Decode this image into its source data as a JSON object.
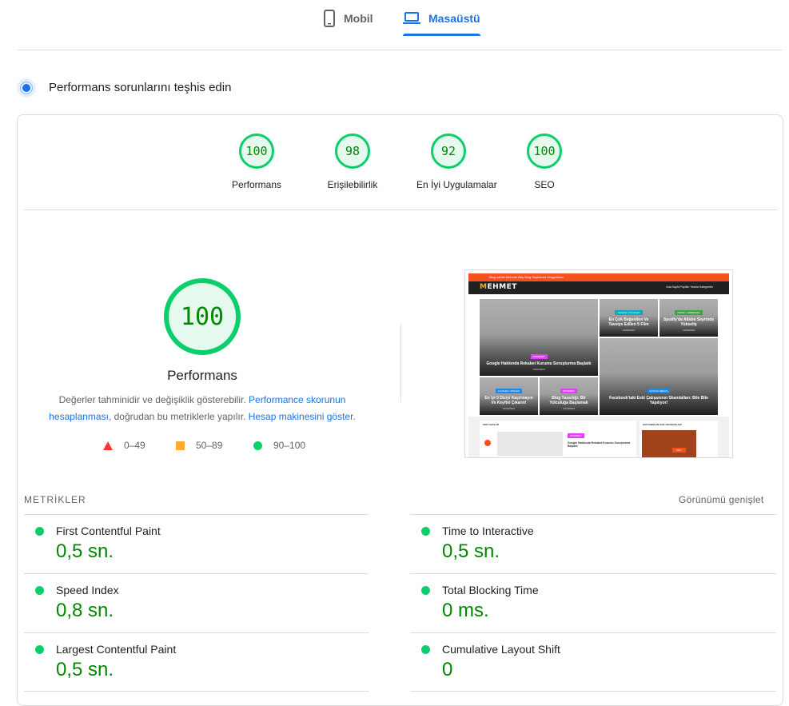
{
  "tabs": {
    "mobile": {
      "label": "Mobil",
      "icon": "phone-icon"
    },
    "desktop": {
      "label": "Masaüstü",
      "icon": "laptop-icon",
      "active": true
    }
  },
  "section": {
    "title": "Performans sorunlarını teşhis edin",
    "icon": "diagnose-icon"
  },
  "categories": [
    {
      "score": "100",
      "label": "Performans"
    },
    {
      "score": "98",
      "label": "Erişilebilirlik"
    },
    {
      "score": "92",
      "label": "En İyi Uygulamalar"
    },
    {
      "score": "100",
      "label": "SEO"
    }
  ],
  "main": {
    "score": "100",
    "label": "Performans",
    "note_text1": "Değerler tahminidir ve değişiklik gösterebilir.",
    "note_link1": "Performance skorunun hesaplanması",
    "note_text2": ", doğrudan bu metriklerle yapılır.",
    "note_link2": "Hesap makinesini göster",
    "note_text3": "."
  },
  "legend": [
    {
      "range": "0–49",
      "color": "#ff3333",
      "shape": "triangle"
    },
    {
      "range": "50–89",
      "color": "#ffaa33",
      "shape": "square"
    },
    {
      "range": "90–100",
      "color": "#0cce6b",
      "shape": "circle"
    }
  ],
  "thumbnail": {
    "topbar": "Blog sahibi Mehmet Bey Blog Sayfasına Hoşgeldiniz",
    "logo_m": "M",
    "logo_rest": "EHMET",
    "nav": "Ana Sayfa    Popüler Yazılar    Kategoriler",
    "tiles": [
      {
        "tag": "İNTERNET",
        "tag_color": "#e040fb",
        "title": "Google Hakkında Rekabet Kurumu Soruşturma Başlattı",
        "date": "13/09/2023"
      },
      {
        "tag": "YAZILIM / OYUNLAR",
        "tag_color": "#00acc1",
        "title": "En Çok Beğenilen Ve Tavsiye Edilen 5 Film",
        "date": "13/09/2023"
      },
      {
        "tag": "MÜZİK / HABERLER",
        "tag_color": "#43a047",
        "title": "Spotify'da Albüm Seyrinde Yükseliş",
        "date": "13/09/2023"
      },
      {
        "tag": "SOSYAL MEDYA",
        "tag_color": "#1e88e5",
        "title": "Facebook'taki Eski Çalışanının Skandalları: Bile Bile Yapılıyor!",
        "date": "13/09/2023"
      },
      {
        "tag": "FİLMLER / DİZİLER",
        "tag_color": "#1e88e5",
        "title": "En İyi 5 Diziyi Kaçırmayın Ve Keyfini Çıkarın!",
        "date": "13/09/2023"
      },
      {
        "tag": "İNTERNET",
        "tag_color": "#e040fb",
        "title": "Blog Yazarlığı: Bir Yolculuğa Başlamak",
        "date": "13/09/2023"
      }
    ],
    "panel_left": "SON YAZILAR",
    "panel_right": "HAFTANIN EN ÇOK OKUNANLARI",
    "panel_tag": "İNTERNET",
    "panel_title": "Google Hakkında Rekabet Kurumu Soruşturma Başlattı",
    "panel_btn": "OKU"
  },
  "metrics": {
    "title": "METRİKLER",
    "expand_label": "Görünümü genişlet",
    "items": [
      {
        "name": "First Contentful Paint",
        "value": "0,5 sn.",
        "status_color": "#0cce6b"
      },
      {
        "name": "Time to Interactive",
        "value": "0,5 sn.",
        "status_color": "#0cce6b"
      },
      {
        "name": "Speed Index",
        "value": "0,8 sn.",
        "status_color": "#0cce6b"
      },
      {
        "name": "Total Blocking Time",
        "value": "0 ms.",
        "status_color": "#0cce6b"
      },
      {
        "name": "Largest Contentful Paint",
        "value": "0,5 sn.",
        "status_color": "#0cce6b"
      },
      {
        "name": "Cumulative Layout Shift",
        "value": "0",
        "status_color": "#0cce6b"
      }
    ]
  }
}
